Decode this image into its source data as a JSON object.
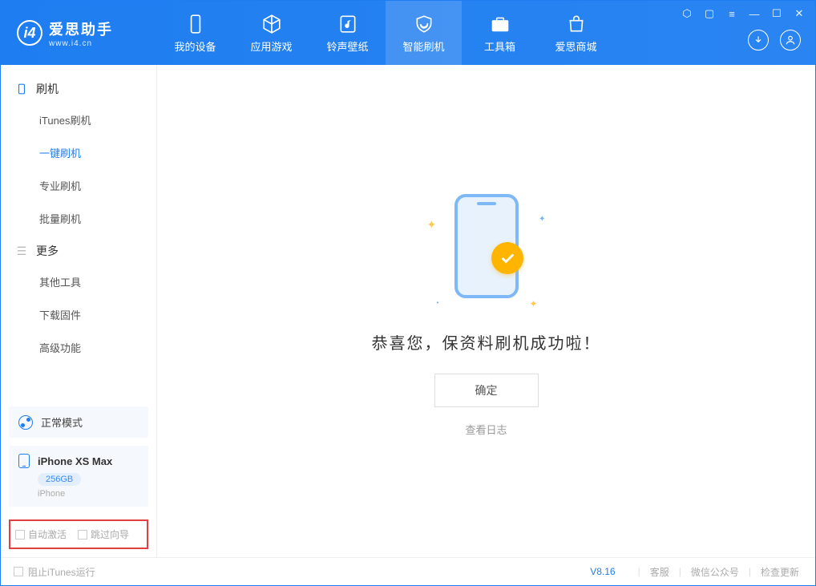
{
  "app": {
    "name": "爱思助手",
    "url": "www.i4.cn"
  },
  "nav": {
    "items": [
      {
        "label": "我的设备"
      },
      {
        "label": "应用游戏"
      },
      {
        "label": "铃声壁纸"
      },
      {
        "label": "智能刷机"
      },
      {
        "label": "工具箱"
      },
      {
        "label": "爱思商城"
      }
    ]
  },
  "sidebar": {
    "section1_title": "刷机",
    "section1_items": [
      "iTunes刷机",
      "一键刷机",
      "专业刷机",
      "批量刷机"
    ],
    "section2_title": "更多",
    "section2_items": [
      "其他工具",
      "下载固件",
      "高级功能"
    ]
  },
  "status": {
    "mode": "正常模式"
  },
  "device": {
    "name": "iPhone XS Max",
    "storage": "256GB",
    "model": "iPhone"
  },
  "options": {
    "auto_activate": "自动激活",
    "skip_guide": "跳过向导"
  },
  "main": {
    "success_text": "恭喜您，保资料刷机成功啦！",
    "ok_button": "确定",
    "view_log": "查看日志"
  },
  "footer": {
    "block_itunes": "阻止iTunes运行",
    "version": "V8.16",
    "links": [
      "客服",
      "微信公众号",
      "检查更新"
    ]
  }
}
